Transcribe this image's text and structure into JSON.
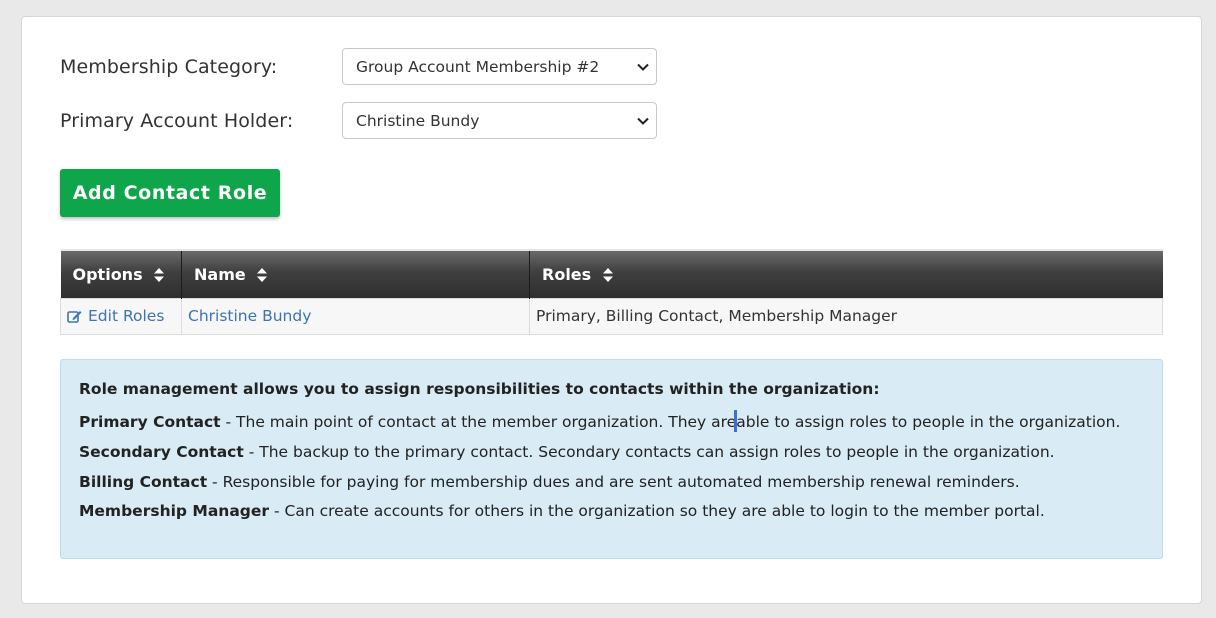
{
  "form": {
    "membership_category_label": "Membership Category:",
    "membership_category_value": "Group Account Membership #2",
    "primary_holder_label": "Primary Account Holder:",
    "primary_holder_value": "Christine Bundy"
  },
  "add_button_label": "Add Contact Role",
  "table": {
    "headers": [
      "Options",
      "Name",
      "Roles"
    ],
    "rows": [
      {
        "option": "Edit Roles",
        "name": "Christine Bundy",
        "roles": "Primary, Billing Contact, Membership Manager"
      }
    ]
  },
  "info": {
    "intro": "Role management allows you to assign responsibilities to contacts within the organization:",
    "items": [
      {
        "term": "Primary Contact",
        "desc_before_cursor": " - The main point of contact at the member organization. They are",
        "desc_after_cursor": "able to assign roles to people in the organization."
      },
      {
        "term": "Secondary Contact",
        "desc": " - The backup to the primary contact. Secondary contacts can assign roles to people in the organization."
      },
      {
        "term": "Billing Contact",
        "desc": " - Responsible for paying for membership dues and are sent automated membership renewal reminders."
      },
      {
        "term": "Membership Manager",
        "desc": " - Can create accounts for others in the organization so they are able to login to the member portal."
      }
    ]
  },
  "colors": {
    "accent_green": "#0fa54a",
    "link_blue": "#3b73b3",
    "info_bg": "#d9ebf5",
    "header_dark": "#3f3f3f"
  },
  "icons": {
    "select_chevron": "chevron-down-icon",
    "sort": "sort-icon",
    "edit": "edit-icon"
  }
}
